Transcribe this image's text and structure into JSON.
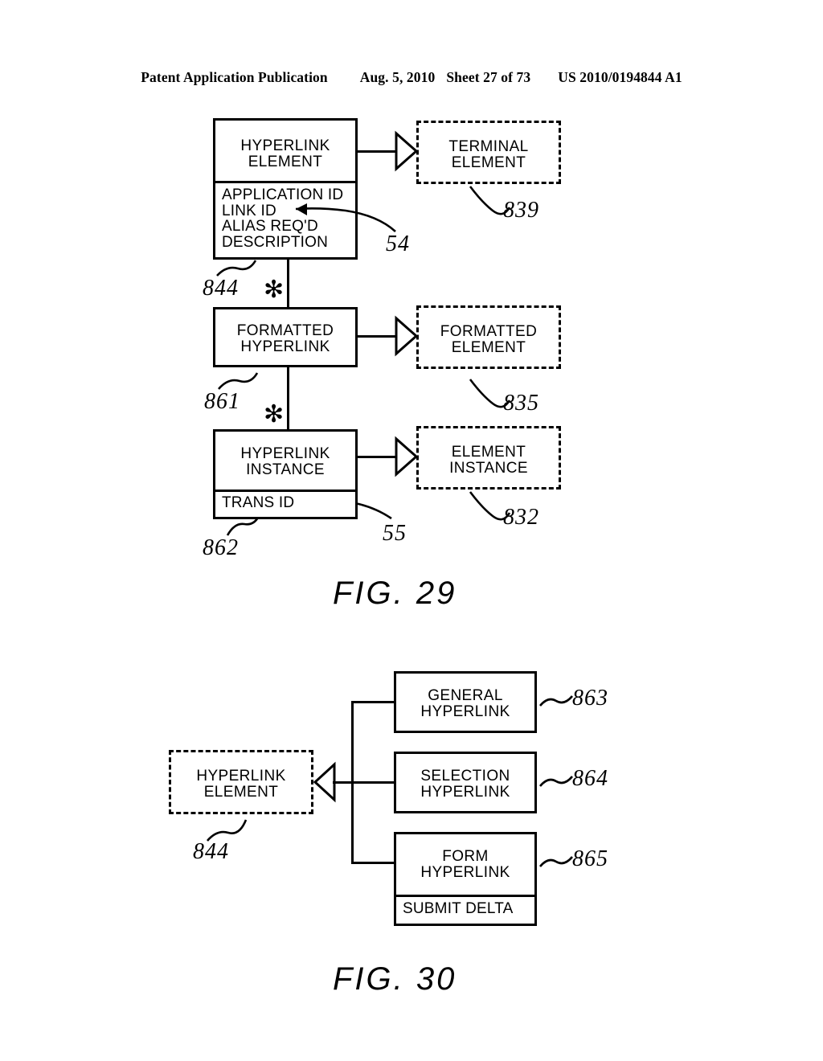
{
  "header": {
    "publication": "Patent Application Publication",
    "date": "Aug. 5, 2010",
    "sheet": "Sheet 27 of 73",
    "docnum": "US 2010/0194844 A1"
  },
  "figures": [
    {
      "caption": "FIG. 29",
      "boxes": [
        {
          "id": "hyperlink-element",
          "title": "HYPERLINK\nELEMENT",
          "attributes": "APPLICATION ID\nLINK ID\nALIAS REQ'D\nDESCRIPTION",
          "style": "solid"
        },
        {
          "id": "terminal-element",
          "title": "TERMINAL\nELEMENT",
          "style": "dashed"
        },
        {
          "id": "formatted-hyperlink",
          "title": "FORMATTED\nHYPERLINK",
          "style": "solid"
        },
        {
          "id": "formatted-element",
          "title": "FORMATTED\nELEMENT",
          "style": "dashed"
        },
        {
          "id": "hyperlink-instance",
          "title": "HYPERLINK\nINSTANCE",
          "attributes": "TRANS ID",
          "style": "solid"
        },
        {
          "id": "element-instance",
          "title": "ELEMENT\nINSTANCE",
          "style": "dashed"
        }
      ],
      "refnums": {
        "terminal_element": "839",
        "link_id_callout": "54",
        "hyperlink_element": "844",
        "formatted_hyperlink": "861",
        "formatted_element": "835",
        "hyperlink_instance": "862",
        "trans_id_callout": "55",
        "element_instance": "832"
      },
      "multiplicity_marker": "✻"
    },
    {
      "caption": "FIG. 30",
      "boxes": [
        {
          "id": "hyperlink-element",
          "title": "HYPERLINK\nELEMENT",
          "style": "dashed"
        },
        {
          "id": "general-hyperlink",
          "title": "GENERAL\nHYPERLINK",
          "style": "solid"
        },
        {
          "id": "selection-hyperlink",
          "title": "SELECTION\nHYPERLINK",
          "style": "solid"
        },
        {
          "id": "form-hyperlink",
          "title": "FORM\nHYPERLINK",
          "attributes": "SUBMIT DELTA",
          "style": "solid"
        }
      ],
      "refnums": {
        "hyperlink_element": "844",
        "general_hyperlink": "863",
        "selection_hyperlink": "864",
        "form_hyperlink": "865"
      }
    }
  ]
}
